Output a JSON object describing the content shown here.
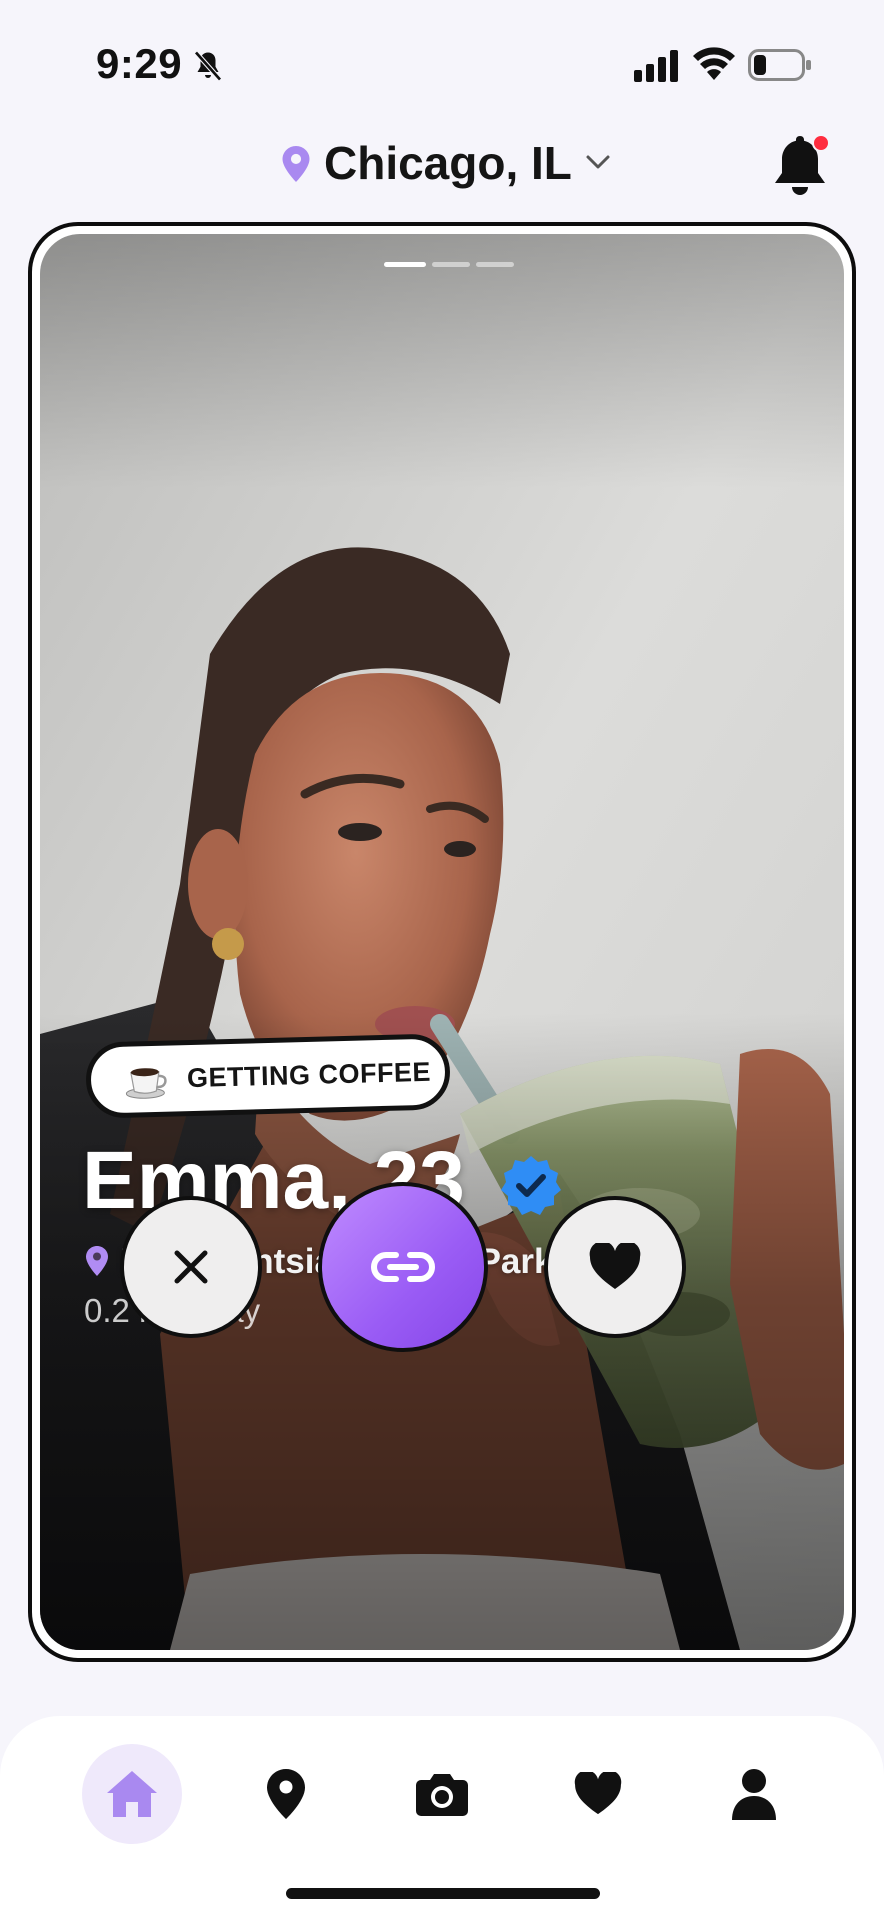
{
  "status_bar": {
    "time": "9:29"
  },
  "header": {
    "location": "Chicago, IL",
    "location_icon": "map-pin-icon",
    "notification_icon": "bell-icon",
    "has_unread": true
  },
  "card": {
    "photo_page_count": 3,
    "photo_page_active": 1,
    "activity": {
      "emoji": "coffee-cup-icon",
      "label": "GETTING COFFEE"
    },
    "profile": {
      "name_age": "Emma, 23",
      "verified": true,
      "venue": "Intelligentsia, Wicker Park",
      "distance": "0.2 mi away"
    },
    "actions": {
      "pass_icon": "close-icon",
      "connect_icon": "link-icon",
      "like_icon": "heart-icon"
    }
  },
  "bottom_nav": {
    "items": [
      {
        "name": "home",
        "icon": "home-icon",
        "active": true
      },
      {
        "name": "map",
        "icon": "map-pin-icon",
        "active": false
      },
      {
        "name": "camera",
        "icon": "camera-icon",
        "active": false
      },
      {
        "name": "likes",
        "icon": "heart-icon",
        "active": false
      },
      {
        "name": "profile",
        "icon": "person-icon",
        "active": false
      }
    ]
  },
  "colors": {
    "accent": "#9a5cf5",
    "accent_light": "#efe9fb",
    "verified_blue": "#2f8df5",
    "notification_red": "#ff2d3f"
  }
}
